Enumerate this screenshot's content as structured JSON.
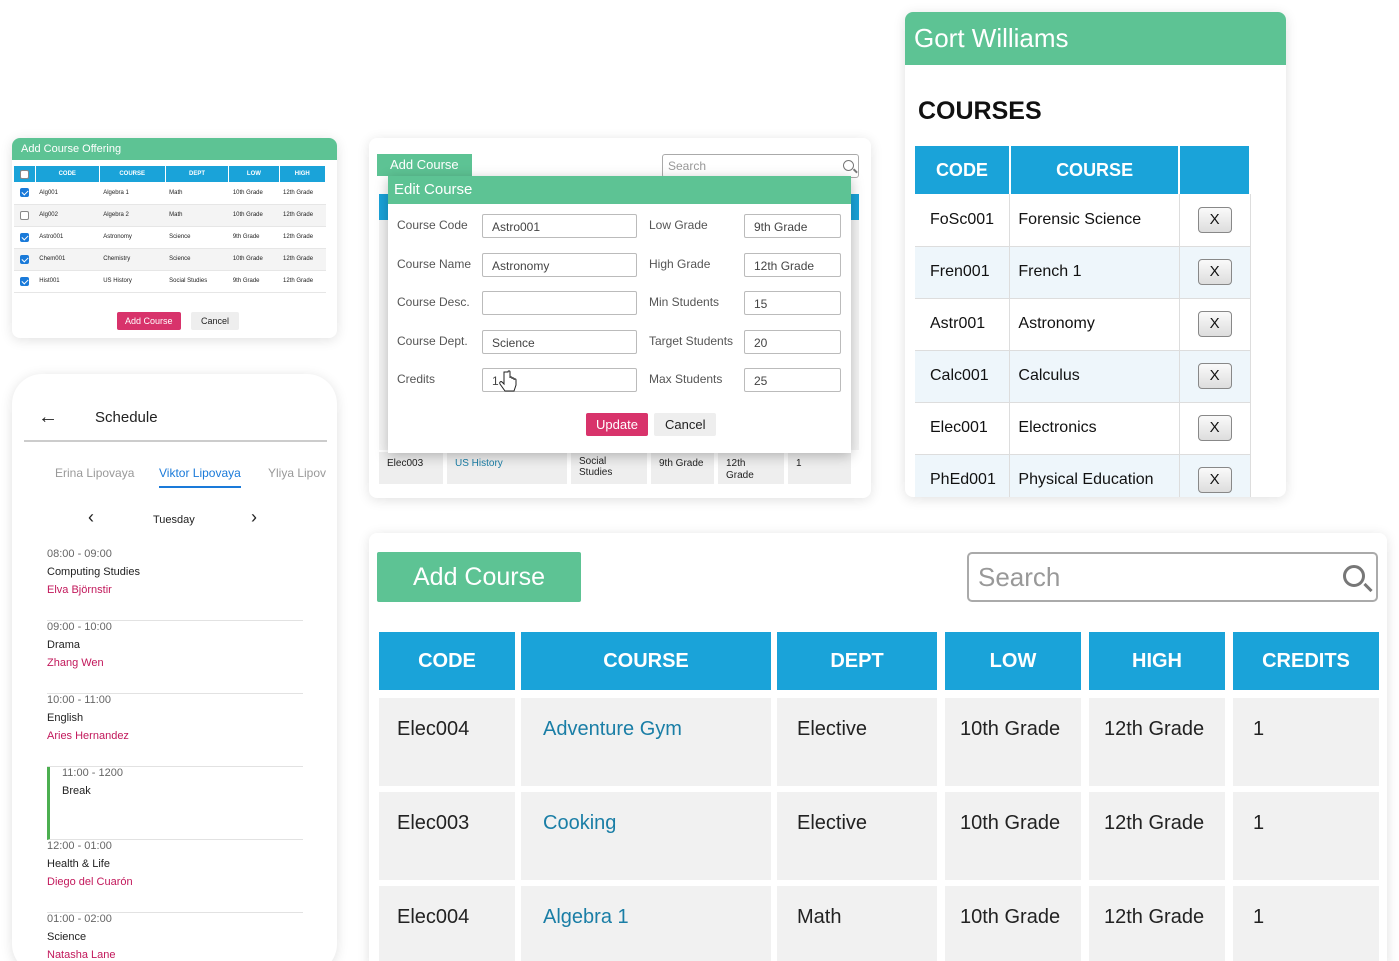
{
  "offering": {
    "title": "Add Course Offering",
    "headers": [
      "CODE",
      "COURSE",
      "DEPT",
      "LOW",
      "HIGH"
    ],
    "rows": [
      {
        "checked": true,
        "code": "Alg001",
        "course": "Algebra 1",
        "dept": "Math",
        "low": "10th Grade",
        "high": "12th Grade"
      },
      {
        "checked": false,
        "code": "Alg002",
        "course": "Algebra 2",
        "dept": "Math",
        "low": "10th Grade",
        "high": "12th Grade"
      },
      {
        "checked": true,
        "code": "Astro001",
        "course": "Astronomy",
        "dept": "Science",
        "low": "9th Grade",
        "high": "12th Grade"
      },
      {
        "checked": true,
        "code": "Chem001",
        "course": "Chemistry",
        "dept": "Science",
        "low": "10th Grade",
        "high": "12th Grade"
      },
      {
        "checked": true,
        "code": "Hist001",
        "course": "US History",
        "dept": "Social Studies",
        "low": "9th Grade",
        "high": "12th Grade"
      }
    ],
    "add_label": "Add Course",
    "cancel_label": "Cancel"
  },
  "edit": {
    "add_tab": "Add Course",
    "search_placeholder": "Search",
    "modal_title": "Edit Course",
    "labels": {
      "code": "Course Code",
      "name": "Course Name",
      "desc": "Course Desc.",
      "dept": "Course Dept.",
      "credits": "Credits",
      "low": "Low Grade",
      "high": "High Grade",
      "min": "Min Students",
      "target": "Target Students",
      "max": "Max Students"
    },
    "values": {
      "code": "Astro001",
      "name": "Astronomy",
      "desc": "",
      "dept": "Science",
      "credits": "1",
      "low": "9th Grade",
      "high": "12th Grade",
      "min": "15",
      "target": "20",
      "max": "25"
    },
    "update_label": "Update",
    "cancel_label": "Cancel",
    "bg_row": {
      "code": "Elec003",
      "course": "US History",
      "dept": "Social Studies",
      "low": "9th Grade",
      "high": "12th Grade",
      "credits": "1"
    }
  },
  "gort": {
    "user": "Gort Williams",
    "title": "COURSES",
    "headers": [
      "CODE",
      "COURSE",
      ""
    ],
    "rows": [
      {
        "code": "FoSc001",
        "course": "Forensic Science",
        "x": "X"
      },
      {
        "code": "Fren001",
        "course": "French 1",
        "x": "X"
      },
      {
        "code": "Astr001",
        "course": "Astronomy",
        "x": "X"
      },
      {
        "code": "Calc001",
        "course": "Calculus",
        "x": "X"
      },
      {
        "code": "Elec001",
        "course": "Electronics",
        "x": "X"
      },
      {
        "code": "PhEd001",
        "course": "Physical Education",
        "x": "X"
      }
    ]
  },
  "schedule": {
    "title": "Schedule",
    "tabs": [
      "Erina Lipovaya",
      "Viktor Lipovaya",
      "Yliya Lipov"
    ],
    "day": "Tuesday",
    "slots": [
      {
        "time": "08:00 - 09:00",
        "subject": "Computing Studies",
        "teacher": "Elva Björnstir"
      },
      {
        "time": "09:00 - 10:00",
        "subject": "Drama",
        "teacher": "Zhang Wen"
      },
      {
        "time": "10:00 - 11:00",
        "subject": "English",
        "teacher": "Aries Hernandez"
      },
      {
        "time": "11:00 - 1200",
        "subject": "Break",
        "teacher": ""
      },
      {
        "time": "12:00 - 01:00",
        "subject": "Health & Life",
        "teacher": "Diego del Cuarón"
      },
      {
        "time": "01:00 - 02:00",
        "subject": "Science",
        "teacher": "Natasha Lane"
      }
    ]
  },
  "big": {
    "add_label": "Add Course",
    "search_placeholder": "Search",
    "headers": [
      "CODE",
      "COURSE",
      "DEPT",
      "LOW",
      "HIGH",
      "CREDITS"
    ],
    "rows": [
      {
        "code": "Elec004",
        "course": "Adventure Gym",
        "dept": "Elective",
        "low": "10th Grade",
        "high": "12th Grade",
        "credits": "1"
      },
      {
        "code": "Elec003",
        "course": "Cooking",
        "dept": "Elective",
        "low": "10th Grade",
        "high": "12th Grade",
        "credits": "1"
      },
      {
        "code": "Elec004",
        "course": "Algebra 1",
        "dept": "Math",
        "low": "10th Grade",
        "high": "12th Grade",
        "credits": "1"
      }
    ]
  },
  "colors": {
    "green": "#5dc394",
    "blue": "#1aa3d9",
    "red": "#d8336b",
    "link": "#1a7ea6",
    "teacher": "#c2185b"
  }
}
